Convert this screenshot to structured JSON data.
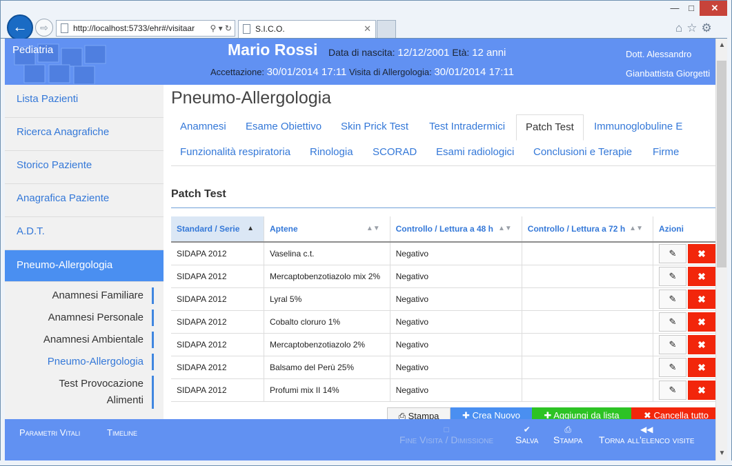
{
  "browser": {
    "url": "http://localhost:5733/ehr#/visitaar",
    "tab_title": "S.I.C.O."
  },
  "header": {
    "brand": "Pediatria",
    "patient_name": "Mario Rossi",
    "dob_label": "Data di nascita:",
    "dob_value": "12/12/2001",
    "age_label": "Età:",
    "age_value": "12 anni",
    "admission_label": "Accettazione:",
    "admission_value": "30/01/2014 17:11",
    "visit_label": "Visita di Allergologia:",
    "visit_value": "30/01/2014 17:11",
    "doctor_line1": "Dott. Alessandro",
    "doctor_line2": "Gianbattista Giorgetti"
  },
  "sidebar": {
    "items": [
      {
        "label": "Lista Pazienti"
      },
      {
        "label": "Ricerca Anagrafiche"
      },
      {
        "label": "Storico Paziente"
      },
      {
        "label": "Anagrafica Paziente"
      },
      {
        "label": "A.D.T."
      },
      {
        "label": "Pneumo-Allergologia"
      }
    ],
    "subitems": [
      {
        "label": "Anamnesi Familiare"
      },
      {
        "label": "Anamnesi Personale"
      },
      {
        "label": "Anamnesi Ambientale"
      },
      {
        "label": "Pneumo-Allergologia"
      },
      {
        "label": "Test Provocazione"
      },
      {
        "label": "Alimenti"
      }
    ]
  },
  "main": {
    "title": "Pneumo-Allergologia",
    "tabs_row1": [
      "Anamnesi",
      "Esame Obiettivo",
      "Skin Prick Test",
      "Test Intradermici",
      "Patch Test",
      "Immunoglobuline E"
    ],
    "tabs_row2": [
      "Funzionalità respiratoria",
      "Rinologia",
      "SCORAD",
      "Esami radiologici",
      "Conclusioni e Terapie",
      "Firme"
    ],
    "panel_title": "Patch Test",
    "columns": [
      "Standard / Serie",
      "Aptene",
      "Controllo / Lettura a 48 h",
      "Controllo / Lettura a 72 h",
      "Azioni"
    ],
    "rows": [
      {
        "serie": "SIDAPA 2012",
        "aptene": "Vaselina c.t.",
        "h48": "Negativo",
        "h72": ""
      },
      {
        "serie": "SIDAPA 2012",
        "aptene": "Mercaptobenzotiazolo mix 2%",
        "h48": "Negativo",
        "h72": ""
      },
      {
        "serie": "SIDAPA 2012",
        "aptene": "Lyral 5%",
        "h48": "Negativo",
        "h72": ""
      },
      {
        "serie": "SIDAPA 2012",
        "aptene": "Cobalto cloruro 1%",
        "h48": "Negativo",
        "h72": ""
      },
      {
        "serie": "SIDAPA 2012",
        "aptene": "Mercaptobenzotiazolo 2%",
        "h48": "Negativo",
        "h72": ""
      },
      {
        "serie": "SIDAPA 2012",
        "aptene": "Balsamo del Perù 25%",
        "h48": "Negativo",
        "h72": ""
      },
      {
        "serie": "SIDAPA 2012",
        "aptene": "Profumi mix II 14%",
        "h48": "Negativo",
        "h72": ""
      }
    ],
    "buttons": {
      "print": "Stampa",
      "new": "Crea Nuovo",
      "add": "Aggiungi da lista",
      "cancel": "Cancella tutto"
    }
  },
  "footer": {
    "vitals": "Parametri Vitali",
    "timeline": "Timeline",
    "end_visit": "Fine Visita / Dimissione",
    "save": "Salva",
    "print": "Stampa",
    "back": "Torna all'elenco visite"
  },
  "colors": {
    "header_blue": "#6191f2",
    "link_blue": "#3478d8",
    "delete_red": "#f2260b",
    "add_green": "#2dc324"
  }
}
